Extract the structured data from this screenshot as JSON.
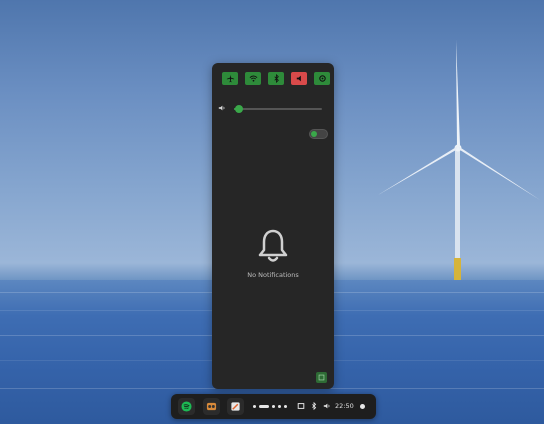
{
  "quick_settings": {
    "toggles": [
      {
        "icon": "airplane-icon",
        "state": "on"
      },
      {
        "icon": "wifi-icon",
        "state": "on"
      },
      {
        "icon": "bluetooth-icon",
        "state": "on"
      },
      {
        "icon": "mute-icon",
        "state": "off"
      },
      {
        "icon": "settings-icon",
        "state": "on"
      }
    ]
  },
  "volume": {
    "level_percent": 6,
    "icon": "speaker-icon"
  },
  "do_not_disturb_toggle": {
    "state": "on"
  },
  "notifications": {
    "empty_text": "No Notifications",
    "icon": "bell-icon"
  },
  "taskbar": {
    "apps": [
      {
        "icon": "spotify-app-icon"
      },
      {
        "icon": "media-app-icon"
      },
      {
        "icon": "editor-app-icon"
      }
    ],
    "clock": "22:50"
  },
  "colors": {
    "accent": "#3aa84a",
    "danger": "#d94a4a",
    "panel": "#262626"
  }
}
